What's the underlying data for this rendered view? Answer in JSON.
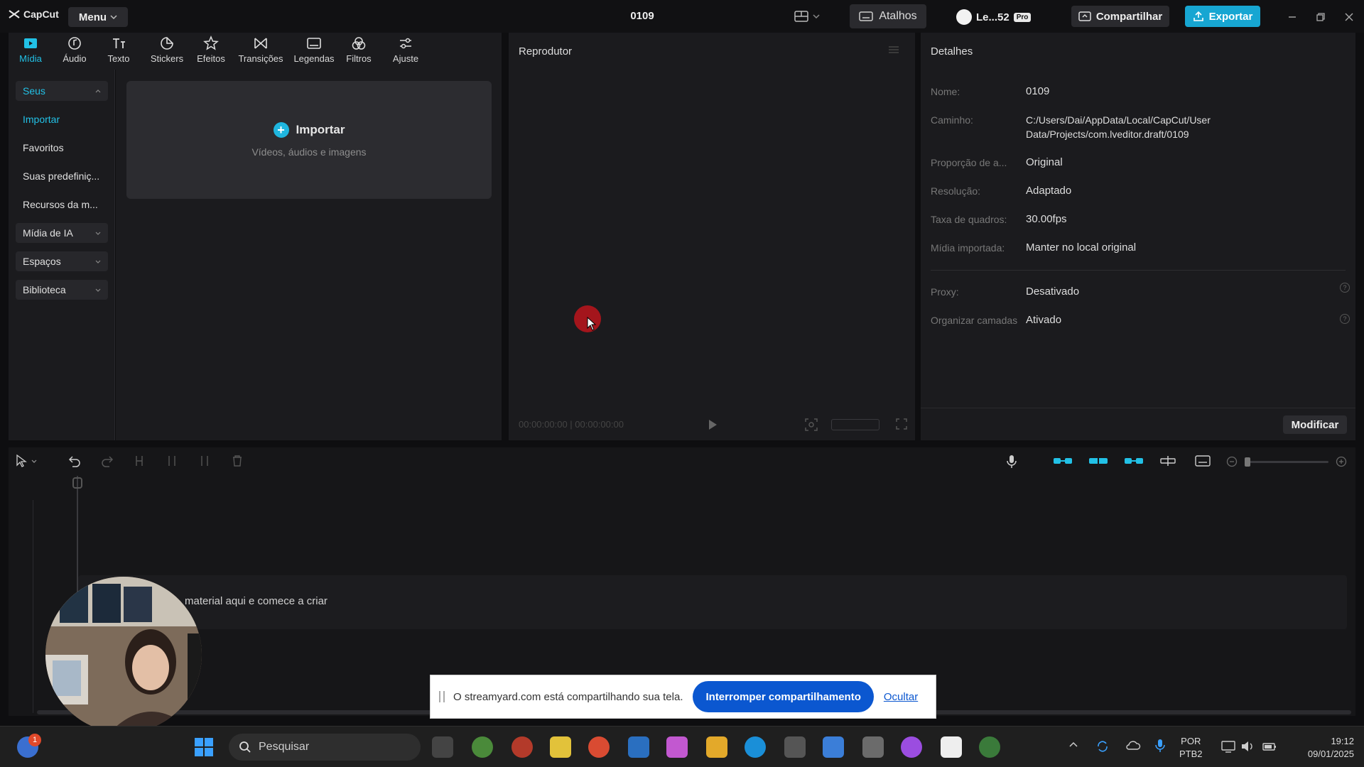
{
  "titlebar": {
    "logo_text": "CapCut",
    "menu_label": "Menu",
    "project_title": "0109",
    "shortcuts_label": "Atalhos",
    "user_label": "Le...52",
    "pro_badge": "Pro",
    "share_label": "Compartilhar",
    "export_label": "Exportar"
  },
  "toolbar": {
    "tabs": [
      {
        "label": "Mídia",
        "icon": "media-icon"
      },
      {
        "label": "Áudio",
        "icon": "audio-icon"
      },
      {
        "label": "Texto",
        "icon": "text-icon"
      },
      {
        "label": "Stickers",
        "icon": "sticker-icon"
      },
      {
        "label": "Efeitos",
        "icon": "effects-icon"
      },
      {
        "label": "Transições",
        "icon": "transitions-icon"
      },
      {
        "label": "Legendas",
        "icon": "captions-icon"
      },
      {
        "label": "Filtros",
        "icon": "filters-icon"
      },
      {
        "label": "Ajuste",
        "icon": "adjust-icon"
      }
    ],
    "active_tab": "Mídia"
  },
  "media": {
    "nav": {
      "seus": "Seus",
      "importar": "Importar",
      "favoritos": "Favoritos",
      "predefinicoes": "Suas predefiniç...",
      "recursos": "Recursos da m...",
      "midia_ia": "Mídia de IA",
      "espacos": "Espaços",
      "biblioteca": "Biblioteca"
    },
    "import": {
      "label": "Importar",
      "sub": "Vídeos, áudios e imagens"
    }
  },
  "player": {
    "title": "Reprodutor",
    "timecode": "00:00:00:00 | 00:00:00:00"
  },
  "details": {
    "title": "Detalhes",
    "rows": {
      "name": {
        "label": "Nome:",
        "value": "0109"
      },
      "path": {
        "label": "Caminho:",
        "value": "C:/Users/Dai/AppData/Local/CapCut/User Data/Projects/com.lveditor.draft/0109"
      },
      "ratio": {
        "label": "Proporção de a...",
        "value": "Original"
      },
      "resolution": {
        "label": "Resolução:",
        "value": "Adaptado"
      },
      "framerate": {
        "label": "Taxa de quadros:",
        "value": "30.00fps"
      },
      "imported_media": {
        "label": "Mídia importada:",
        "value": "Manter no local original"
      },
      "proxy": {
        "label": "Proxy:",
        "value": "Desativado"
      },
      "layers": {
        "label": "Organizar camadas",
        "value": "Ativado"
      }
    },
    "modify_label": "Modificar"
  },
  "timeline": {
    "hint": "material aqui e comece a criar"
  },
  "share_bar": {
    "text": "O streamyard.com está compartilhando sua tela.",
    "stop_label": "Interromper compartilhamento",
    "hide_label": "Ocultar"
  },
  "taskbar": {
    "search_placeholder": "Pesquisar",
    "notification_count": "1",
    "lang_line1": "POR",
    "lang_line2": "PTB2",
    "time": "19:12",
    "date": "09/01/2025"
  },
  "colors": {
    "accent": "#22c1e6",
    "export": "#17a6d2",
    "share_stop": "#0b57d0"
  }
}
